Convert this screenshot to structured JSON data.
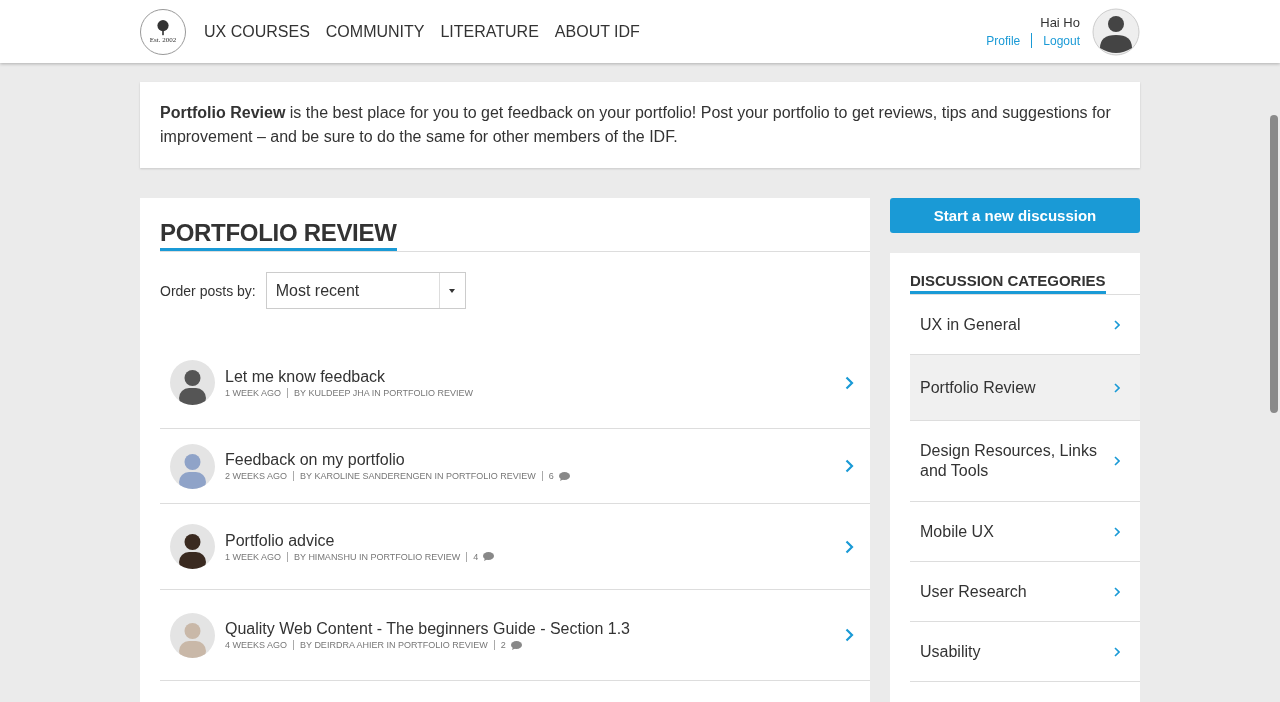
{
  "header": {
    "logo_caption": "Est. 2002",
    "nav": [
      "UX COURSES",
      "COMMUNITY",
      "LITERATURE",
      "ABOUT IDF"
    ],
    "user": {
      "name": "Hai Ho",
      "links": [
        "Profile",
        "Logout"
      ]
    }
  },
  "intro": "**Portfolio Review** is the best place for you to get feedback on your portfolio! Post your portfolio to get reviews, tips and suggestions for improvement – and be sure to do the same for other members of the IDF.",
  "main": {
    "title": "PORTFOLIO REVIEW",
    "order_label": "Order posts by:",
    "order_value": "Most recent",
    "posts": [
      {
        "title": "Let me know feedback",
        "age": "1 WEEK AGO",
        "byline": "BY KULDEEP JHA IN PORTFOLIO REVIEW"
      },
      {
        "title": "Feedback on my portfolio",
        "age": "2 WEEKS AGO",
        "byline": "BY KAROLINE SANDERENGEN IN PORTFOLIO REVIEW",
        "comments": "6"
      },
      {
        "title": "Portfolio advice",
        "age": "1 WEEK AGO",
        "byline": "BY HIMANSHU IN PORTFOLIO REVIEW",
        "comments": "4"
      },
      {
        "title": "Quality Web Content - The beginners Guide - Section 1.3",
        "age": "4 WEEKS AGO",
        "byline": "BY DEIRDRA AHIER IN PORTFOLIO REVIEW",
        "comments": "2"
      }
    ]
  },
  "sidebar": {
    "button": "Start a new discussion",
    "categories_title": "DISCUSSION CATEGORIES",
    "categories": [
      {
        "label": "UX in General",
        "selected": false
      },
      {
        "label": "Portfolio Review",
        "selected": true
      },
      {
        "label": "Design Resources, Links and Tools",
        "selected": false
      },
      {
        "label": "Mobile UX",
        "selected": false
      },
      {
        "label": "User Research",
        "selected": false
      },
      {
        "label": "Usability",
        "selected": false
      }
    ]
  }
}
